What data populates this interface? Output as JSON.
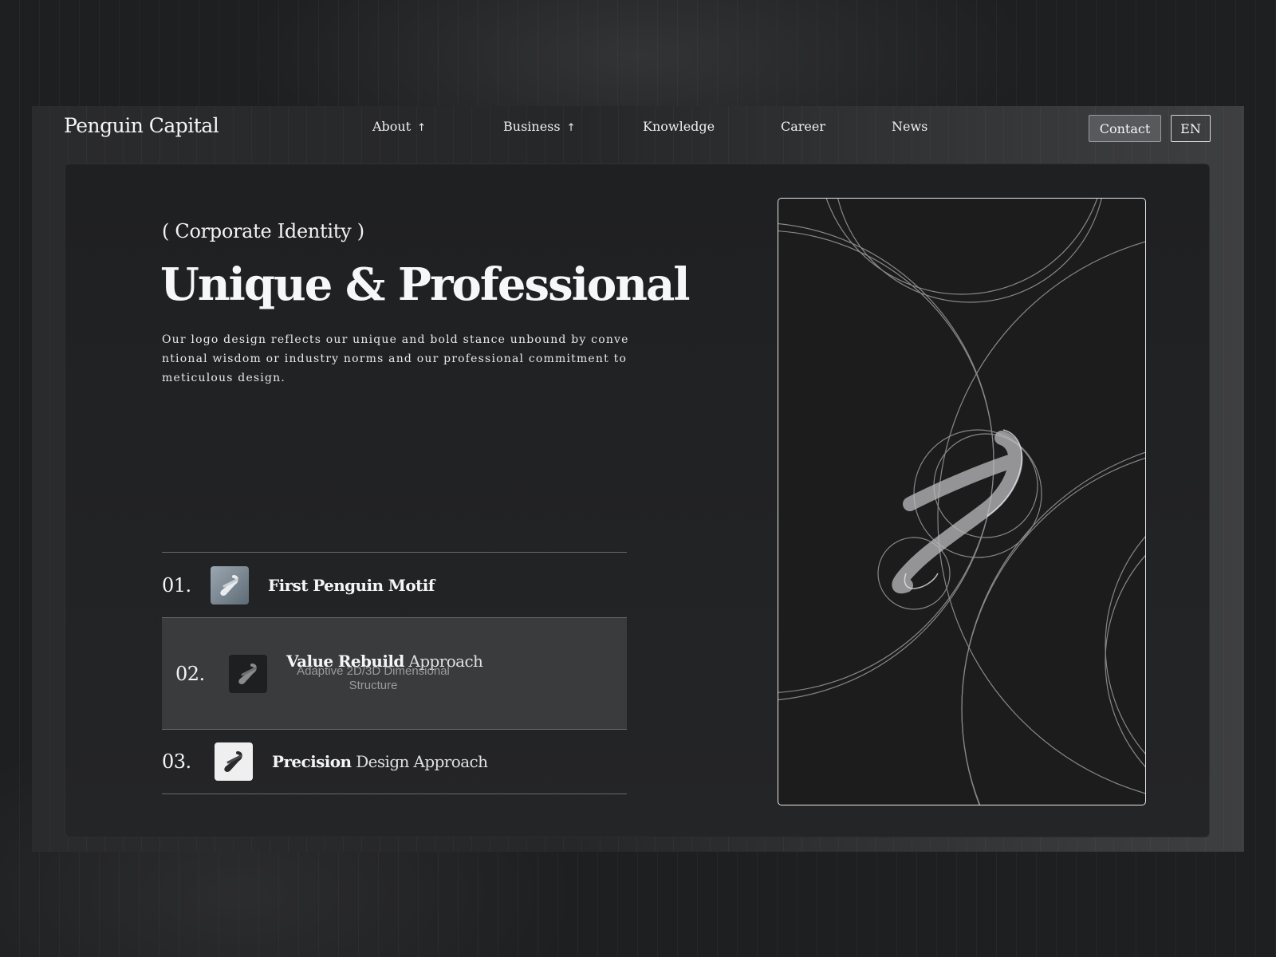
{
  "brand": "Penguin Capital",
  "nav": {
    "items": [
      {
        "label": "About",
        "arrow": "↑"
      },
      {
        "label": "Business",
        "arrow": "↑"
      },
      {
        "label": "Knowledge"
      },
      {
        "label": "Career"
      },
      {
        "label": "News"
      }
    ],
    "contact_label": "Contact",
    "lang_label": "EN"
  },
  "hero": {
    "eyebrow": "( Corporate Identity )",
    "headline": "Unique & Professional",
    "description": "Our logo design reflects our unique and bold stance unbound by conventional wisdom or industry norms and our professional commitment to meticulous design."
  },
  "features": [
    {
      "number": "01.",
      "title_bold": "First Penguin Motif",
      "title_light": "",
      "icon": "penguin-logo-icon"
    },
    {
      "number": "02.",
      "title_bold": "Value Rebuild",
      "title_light": "Approach",
      "subtitle": "Adaptive 2D/3D Dimensional Structure",
      "icon": "penguin-logo-icon"
    },
    {
      "number": "03.",
      "title_bold": "Precision",
      "title_light": "Design Approach",
      "icon": "penguin-logo-icon"
    }
  ],
  "colors": {
    "background": "#1e1f21",
    "panel": "#1f2022",
    "active_row": "#3a3b3d",
    "contact_button": "#58595c",
    "text": "#f5f5f5",
    "muted_text": "#9a9a9c"
  }
}
